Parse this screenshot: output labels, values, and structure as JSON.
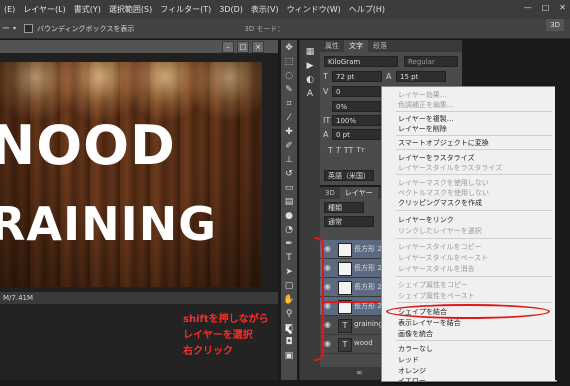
{
  "menubar": {
    "app_icon": "Ps",
    "items": [
      "レイヤー(L)",
      "書式(Y)",
      "選択範囲(S)",
      "フィルター(T)",
      "3D(D)",
      "表示(V)",
      "ウィンドウ(W)",
      "ヘルプ(H)"
    ],
    "first_item_partial": "(E)"
  },
  "options_bar": {
    "tool_label": "ー",
    "bounding_box_checkbox": "バウンディングボックスを表示",
    "mode_label": "3D モード："
  },
  "workspace": {
    "label": "3D"
  },
  "document": {
    "canvas_text_line1": "NOOD",
    "canvas_text_line2": "RAINING",
    "status_text": "M/7.41M"
  },
  "character_panel": {
    "tabs": [
      "属性",
      "文字",
      "段落"
    ],
    "font_family": "KiloGram",
    "font_style": "Regular",
    "font_size": "72 pt",
    "leading": "15 pt",
    "kerning": "0",
    "tracking": "0%",
    "vertical_scale": "100%",
    "baseline_shift": "0 pt",
    "language": "英語（米国）"
  },
  "layers_panel": {
    "tab": "レイヤー",
    "filter": "種類",
    "blend_mode": "通常",
    "layers": [
      {
        "name": "長方形 2",
        "type": "shape",
        "selected": true
      },
      {
        "name": "長方形 2",
        "type": "shape",
        "selected": true
      },
      {
        "name": "長方形 2",
        "type": "shape",
        "selected": true
      },
      {
        "name": "長方形 2",
        "type": "shape",
        "selected": true
      },
      {
        "name": "graining",
        "type": "text",
        "selected": false
      },
      {
        "name": "wood",
        "type": "text",
        "selected": false
      }
    ]
  },
  "context_menu": {
    "items": [
      {
        "label": "レイヤー効果...",
        "enabled": false
      },
      {
        "label": "色調補正を編集...",
        "enabled": false
      },
      {
        "sep": true
      },
      {
        "label": "レイヤーを複製...",
        "enabled": true
      },
      {
        "label": "レイヤーを削除",
        "enabled": true
      },
      {
        "sep": true
      },
      {
        "label": "スマートオブジェクトに変換",
        "enabled": true
      },
      {
        "sep": true
      },
      {
        "label": "レイヤーをラスタライズ",
        "enabled": true
      },
      {
        "label": "レイヤースタイルをラスタライズ",
        "enabled": false
      },
      {
        "sep": true
      },
      {
        "label": "レイヤーマスクを使用しない",
        "enabled": false
      },
      {
        "label": "ベクトルマスクを使用しない",
        "enabled": false
      },
      {
        "label": "クリッピングマスクを作成",
        "enabled": true
      },
      {
        "sep": true
      },
      {
        "label": "レイヤーをリンク",
        "enabled": true
      },
      {
        "label": "リンクしたレイヤーを選択",
        "enabled": false
      },
      {
        "sep": true
      },
      {
        "label": "レイヤースタイルをコピー",
        "enabled": false
      },
      {
        "label": "レイヤースタイルをペースト",
        "enabled": false
      },
      {
        "label": "レイヤースタイルを消去",
        "enabled": false
      },
      {
        "sep": true
      },
      {
        "label": "シェイプ属性をコピー",
        "enabled": false
      },
      {
        "label": "シェイプ属性をペースト",
        "enabled": false
      },
      {
        "sep": true
      },
      {
        "label": "シェイプを結合",
        "enabled": true,
        "highlighted": true
      },
      {
        "label": "表示レイヤーを結合",
        "enabled": true
      },
      {
        "label": "画像を統合",
        "enabled": true
      },
      {
        "sep": true
      },
      {
        "label": "カラーなし",
        "enabled": true
      },
      {
        "label": "レッド",
        "enabled": true
      },
      {
        "label": "オレンジ",
        "enabled": true
      },
      {
        "label": "イエロー",
        "enabled": true
      }
    ]
  },
  "annotation": {
    "line1": "shiftを押しながら",
    "line2": "レイヤーを選択",
    "line3": "右クリック",
    "color": "#ff2a2a"
  }
}
